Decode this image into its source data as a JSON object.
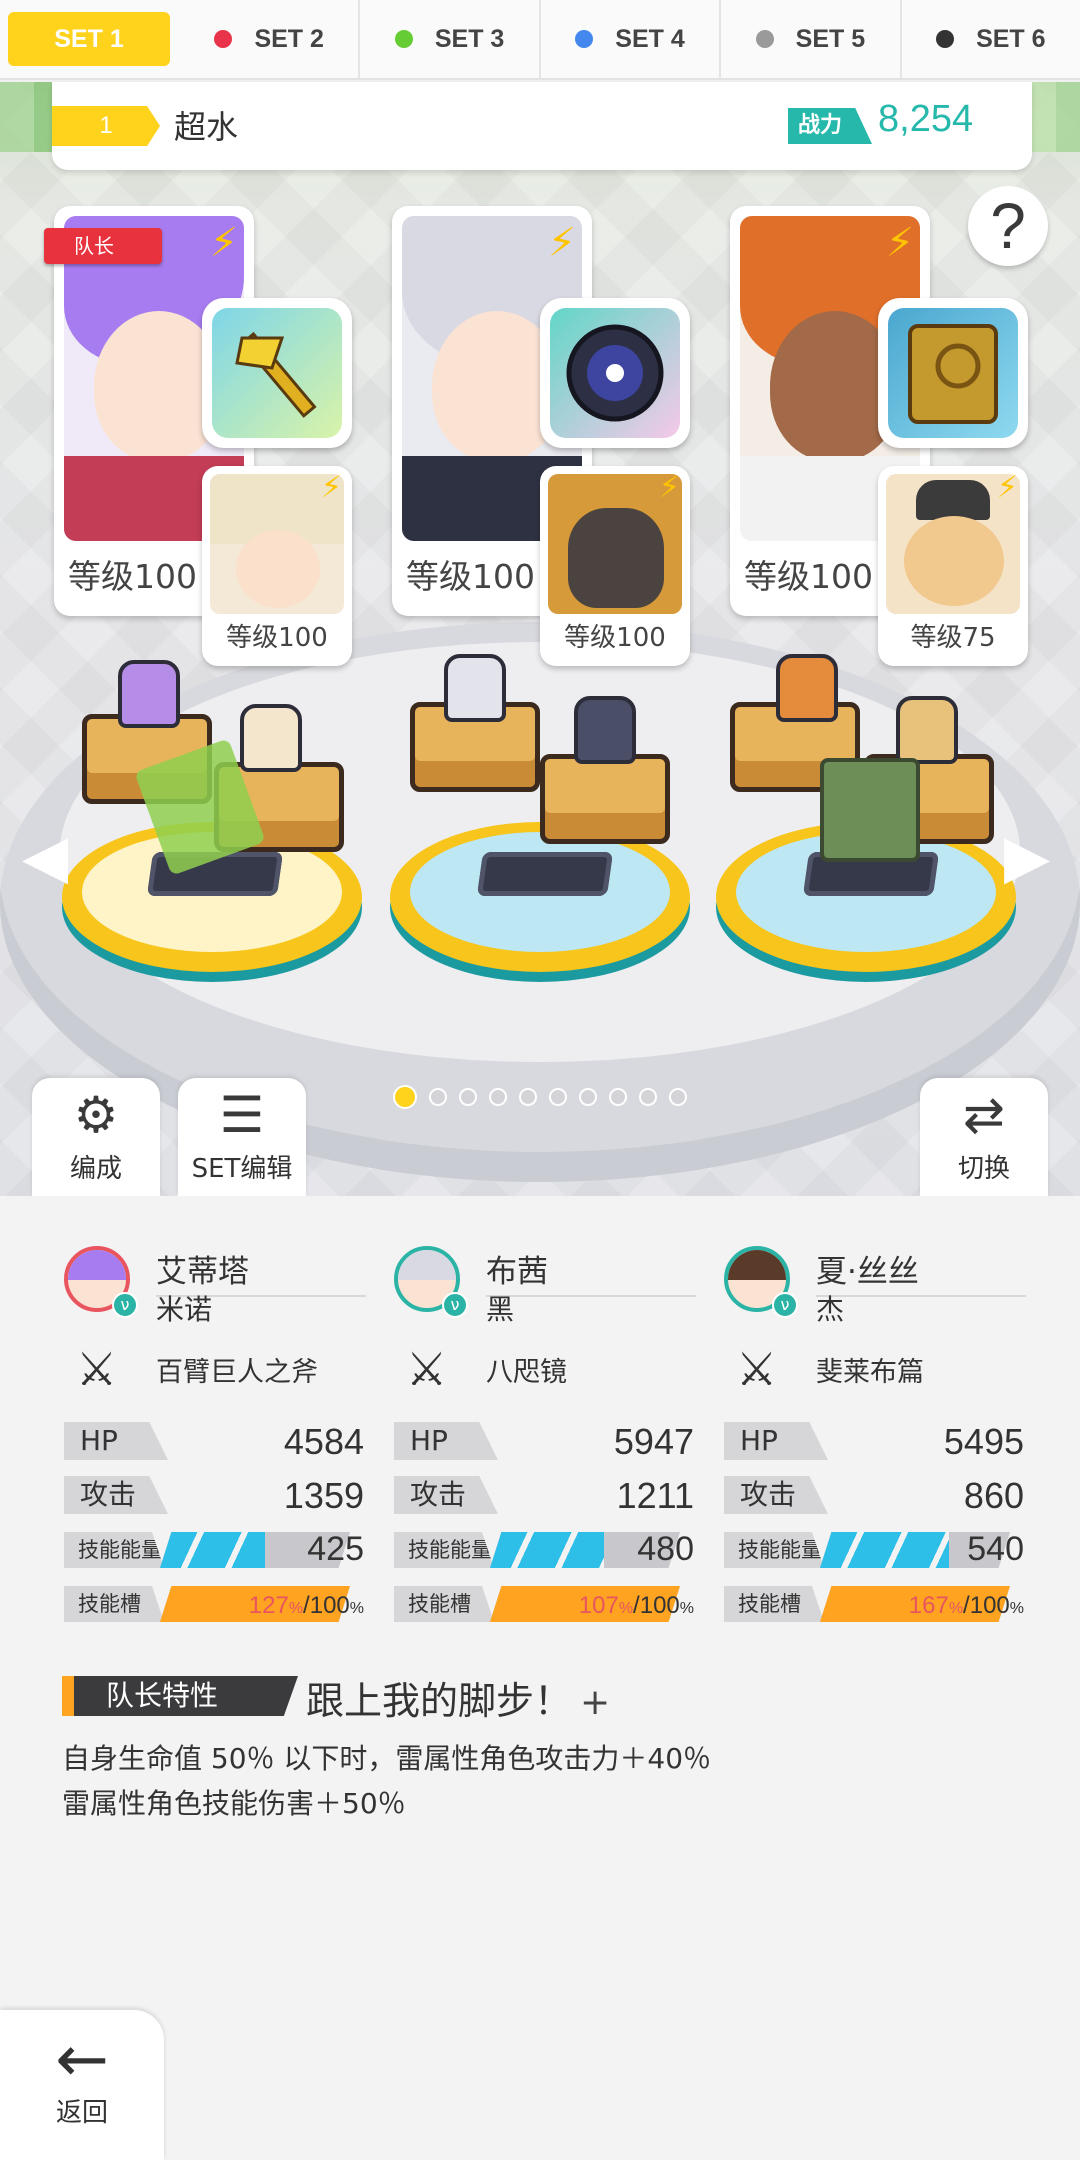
{
  "tabs": [
    {
      "label": "SET 1",
      "active": true,
      "dot_color": ""
    },
    {
      "label": "SET 2",
      "active": false,
      "dot_color": "#e8334a"
    },
    {
      "label": "SET 3",
      "active": false,
      "dot_color": "#66cc33"
    },
    {
      "label": "SET 4",
      "active": false,
      "dot_color": "#4488ee"
    },
    {
      "label": "SET 5",
      "active": false,
      "dot_color": "#9a9a9a"
    },
    {
      "label": "SET 6",
      "active": false,
      "dot_color": "#333333"
    }
  ],
  "party": {
    "number": "1",
    "name": "超水",
    "power_label": "战力",
    "power_value": "8,254"
  },
  "help_label": "?",
  "leader_tag": "队长",
  "cards": [
    {
      "level": "等级100",
      "sub_level": "等级100"
    },
    {
      "level": "等级100",
      "sub_level": "等级100"
    },
    {
      "level": "等级100",
      "sub_level": "等级75"
    }
  ],
  "buttons": {
    "formation": "编成",
    "set_edit": "SET编辑",
    "switch": "切换",
    "back": "返回"
  },
  "page_indicator": {
    "total": 10,
    "current": 1
  },
  "heroes": [
    {
      "name": "艾蒂塔",
      "partner": "米诺",
      "weapon": "百臂巨人之斧",
      "hp_label": "HP",
      "hp": "4584",
      "atk_label": "攻击",
      "atk": "1359",
      "energy_label": "技能能量",
      "energy": "425",
      "energy_fill": 0.55,
      "slot_label": "技能槽",
      "slot_current": "127",
      "slot_max": "/100",
      "avatar_color": "#a77cf0"
    },
    {
      "name": "布茜",
      "partner": "黑",
      "weapon": "八咫镜",
      "hp_label": "HP",
      "hp": "5947",
      "atk_label": "攻击",
      "atk": "1211",
      "energy_label": "技能能量",
      "energy": "480",
      "energy_fill": 0.6,
      "slot_label": "技能槽",
      "slot_current": "107",
      "slot_max": "/100",
      "avatar_color": "#d9d9e3"
    },
    {
      "name": "夏·丝丝",
      "partner": "杰",
      "weapon": "斐莱布篇",
      "hp_label": "HP",
      "hp": "5495",
      "atk_label": "攻击",
      "atk": "860",
      "energy_label": "技能能量",
      "energy": "540",
      "energy_fill": 0.68,
      "slot_label": "技能槽",
      "slot_current": "167",
      "slot_max": "/100",
      "avatar_color": "#5a3a28"
    }
  ],
  "percent_sign": "%",
  "leader_skill": {
    "header": "队长特性",
    "title": "跟上我的脚步！",
    "plus": "+",
    "lines": [
      "自身生命值 50％ 以下时，雷属性角色攻击力＋40％",
      "雷属性角色技能伤害＋50％"
    ]
  },
  "colors": {
    "accent_yellow": "#ffd21c",
    "teal": "#26b8ab",
    "orange": "#ffa321",
    "red": "#e8555f",
    "skill_blue": "#2ebfe9"
  }
}
